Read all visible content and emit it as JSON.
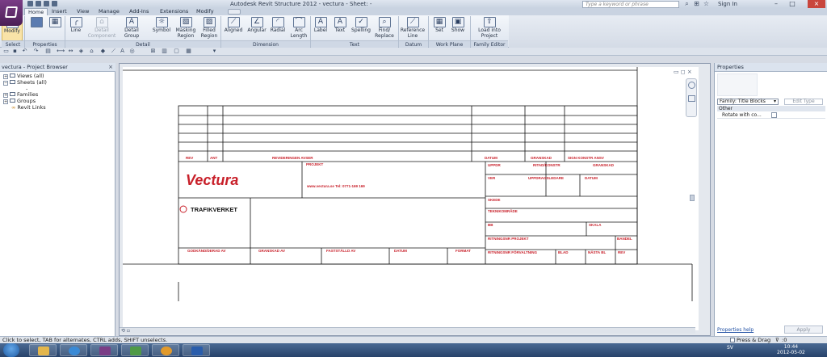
{
  "window": {
    "title": "Autodesk Revit Structure 2012 -    vectura - Sheet: -",
    "search_placeholder": "Type a keyword or phrase",
    "sign_in": "Sign In"
  },
  "tabs": [
    "Home",
    "Insert",
    "View",
    "Manage",
    "Add-Ins",
    "Extensions",
    "Modify"
  ],
  "ribbon": {
    "buttons": {
      "modify": "Modify",
      "line": "Line",
      "detail_component": "Detail Component",
      "detail_group": "Detail Group",
      "symbol": "Symbol",
      "masking_region": "Masking Region",
      "filled_region": "Filled Region",
      "aligned": "Aligned",
      "angular": "Angular",
      "radial": "Radial",
      "arc_length": "Arc Length",
      "label": "Label",
      "text": "Text",
      "spelling": "Spelling",
      "find_replace": "Find/ Replace",
      "reference_line": "Reference Line",
      "set": "Set",
      "show": "Show",
      "load_into_project": "Load into Project"
    },
    "groups": {
      "select": "Select",
      "properties": "Properties",
      "detail": "Detail",
      "dimension": "Dimension",
      "text": "Text",
      "datum": "Datum",
      "work_plane": "Work Plane",
      "family_editor": "Family Editor"
    }
  },
  "project_browser": {
    "title": "vectura - Project Browser",
    "items": {
      "views": "Views (all)",
      "sheets": "Sheets (all)",
      "sheet_child": "-",
      "families": "Families",
      "groups": "Groups",
      "revit_links": "Revit Links"
    }
  },
  "title_block": {
    "rev_headers": {
      "rev": "REV",
      "ant": "ANT",
      "revidering": "REVIDERINGEN AVSER",
      "datum": "DATUM",
      "granskad": "GRANSKAD",
      "konstr": "SIGN KONSTR ANSV"
    },
    "logos": {
      "vectura": "Vectura",
      "trafikverket": "TRAFIKVERKET"
    },
    "fields": {
      "projekt": "PROJEKT",
      "contact": "www.vectura.se   Tel: 0771-169 169",
      "uppdr": "UPPDR",
      "ritadkonstr": "RITAD/KONSTR",
      "granskad": "GRANSKAD",
      "ver": "VER",
      "uppdragsledare": "UPPDRAGSLEDARE",
      "datum": "DATUM",
      "skede": "SKEDE",
      "teknikomrade": "TEKNIKOMRÅDE",
      "bb": "BB",
      "skala": "SKALA",
      "ritningsnr_projekt": "RITNINGSNR PROJEKT",
      "bandel": "BANDEL",
      "godkand": "GODKÄND/DERAD AV",
      "granskad_av": "GRANSKAD AV",
      "faststalld": "FASTSTÄLLD AV",
      "datum2": "DATUM",
      "format": "FORMAT",
      "ritningsnr_forv": "RITNINGSNR FÖRVALTNING",
      "blad": "BLAD",
      "nasta_bl": "NÄSTA BL",
      "rev2": "REV"
    }
  },
  "properties": {
    "title": "Properties",
    "family": "Family: Title Blocks",
    "edit_type": "Edit Type",
    "section": "Other",
    "rotate_label": "Rotate with co...",
    "help": "Properties help",
    "apply": "Apply"
  },
  "status": {
    "text": "Click to select, TAB for alternates, CTRL adds, SHIFT unselects.",
    "press_drag": "Press & Drag",
    "zero": ":0"
  },
  "taskbar": {
    "lang": "SV",
    "time": "10:44",
    "date": "2012-05-02"
  },
  "colors": {
    "titleblock_red": "#c8202a",
    "ribbon_bg": "#e8edf4",
    "modify_highlight": "#f9e3a8"
  }
}
